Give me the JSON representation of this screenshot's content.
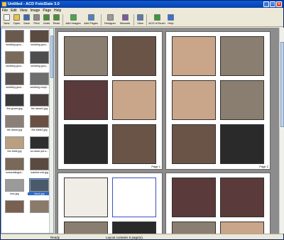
{
  "window": {
    "title": "Untitled - ACD FotoSlate 3.0"
  },
  "menu": [
    "File",
    "Edit",
    "View",
    "Image",
    "Page",
    "Help"
  ],
  "toolbar": [
    {
      "label": "New",
      "icon": "new-icon",
      "color": "#f4f4f4"
    },
    {
      "label": "Open",
      "icon": "open-folder-icon",
      "color": "#e9c44a"
    },
    {
      "label": "Save",
      "icon": "save-disk-icon",
      "color": "#3f67b0"
    },
    {
      "label": "Print",
      "icon": "printer-icon",
      "color": "#8a8a8a"
    },
    {
      "label": "Undo",
      "icon": "undo-icon",
      "color": "#4a8e3a"
    },
    {
      "label": "Redo",
      "icon": "redo-icon",
      "color": "#4a8e3a"
    },
    {
      "label": "Add Images",
      "icon": "add-images-icon",
      "color": "#4aa64a"
    },
    {
      "label": "Add Pages",
      "icon": "add-pages-icon",
      "color": "#5080c8"
    },
    {
      "label": "Designer",
      "icon": "designer-icon",
      "color": "#9a9a9a"
    },
    {
      "label": "Wizards",
      "icon": "wizard-wand-icon",
      "color": "#7a5aa0"
    },
    {
      "label": "View",
      "icon": "view-icon",
      "color": "#5a7ab0"
    },
    {
      "label": "ACD InTouch",
      "icon": "acd-intouch-icon",
      "color": "#3a9a3a"
    },
    {
      "label": "Help",
      "icon": "help-icon",
      "color": "#3a6fd8"
    }
  ],
  "thumbnails": [
    {
      "caption": "wedding grou...",
      "color": "#6a5a4e"
    },
    {
      "caption": "wedding grou...",
      "color": "#5a4a40"
    },
    {
      "caption": "wedding grou...",
      "color": "#7a6a5a"
    },
    {
      "caption": "wedding grou...",
      "color": "#4e4e4e"
    },
    {
      "caption": "wedding grou...",
      "color": "#5c5450"
    },
    {
      "caption": "wedding coupl...",
      "color": "#6e6e6e"
    },
    {
      "caption": "the groom.jpg",
      "color": "#3a3a3a"
    },
    {
      "caption": "the dance1.jpg",
      "color": "#4a4040"
    },
    {
      "caption": "the dance.jpg",
      "color": "#8a8078"
    },
    {
      "caption": "the-bride2.jpg",
      "color": "#6a5044"
    },
    {
      "caption": "the-bride.jpg",
      "color": "#b8a080"
    },
    {
      "caption": "so-close-yet-s...",
      "color": "#2e2e2e"
    },
    {
      "caption": "ourweddingint...",
      "color": "#7a6858"
    },
    {
      "caption": "married-exit.jpg",
      "color": "#5a4a40"
    },
    {
      "caption": "limo.jpg",
      "color": "#9a9a9a"
    },
    {
      "caption": "kiss1.jpg",
      "color": "#4a5a6a",
      "selected": true
    },
    {
      "caption": "",
      "color": "#7a6050"
    },
    {
      "caption": "",
      "color": "#8a7a6a"
    }
  ],
  "pages": {
    "page1_label": "Page 1",
    "page2_label": "Page 2"
  },
  "photo_colors": {
    "church": "#8a7e70",
    "dark": "#2a2a2a",
    "couple": "#6a5448",
    "portrait": "#c9a58a",
    "group": "#5a3a3a",
    "white": "#f0ece6"
  },
  "status": {
    "left": "Ready",
    "mid": "Layout contains 5 page(s)."
  }
}
